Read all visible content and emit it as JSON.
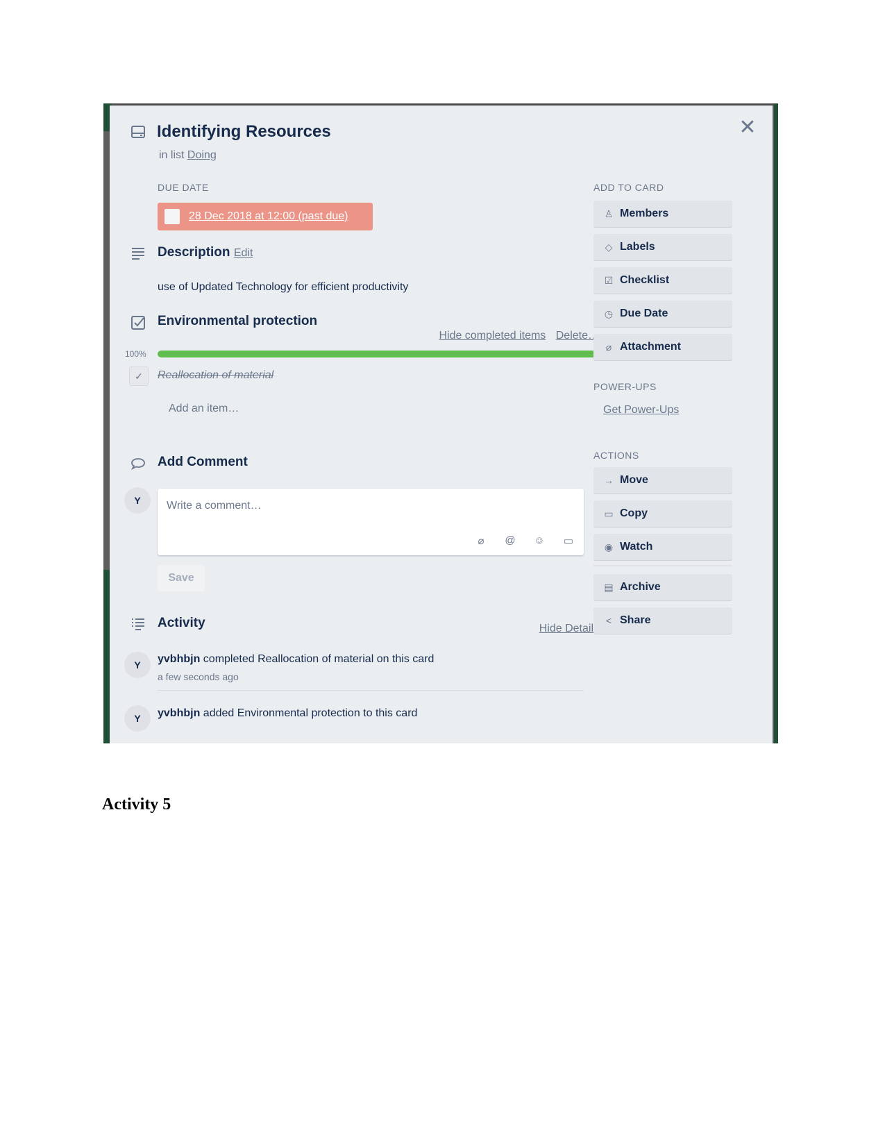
{
  "card": {
    "title": "Identifying Resources",
    "in_list_prefix": "in list",
    "list_name": "Doing",
    "close_icon": "close-icon"
  },
  "due_date": {
    "label": "Due Date",
    "value": "28 Dec 2018 at 12:00 (past due)",
    "status_color": "#ec9488",
    "completed": false
  },
  "description": {
    "title": "Description",
    "edit_label": "Edit",
    "text": "use of Updated Technology for efficient productivity"
  },
  "checklist": {
    "title": "Environmental protection",
    "hide_completed_label": "Hide completed items",
    "delete_label": "Delete…",
    "progress_percent_label": "100%",
    "progress_fraction": 1.0,
    "progress_color": "#61bd4f",
    "items": [
      {
        "text": "Reallocation of material",
        "checked": true
      }
    ],
    "add_item_label": "Add an item…"
  },
  "comment": {
    "title": "Add Comment",
    "avatar_initial": "Y",
    "placeholder": "Write a comment…",
    "tools": [
      "attachment-icon",
      "mention-icon",
      "emoji-icon",
      "card-icon"
    ],
    "tool_glyphs": [
      "⌀",
      "@",
      "☺",
      "▭"
    ],
    "save_label": "Save"
  },
  "activity": {
    "title": "Activity",
    "hide_details_label": "Hide Details",
    "entries": [
      {
        "avatar": "Y",
        "user": "yvbhbjn",
        "action": "completed Reallocation of material on this card",
        "time": "a few seconds ago"
      },
      {
        "avatar": "Y",
        "user": "yvbhbjn",
        "action": "added Environmental protection to this card",
        "time": ""
      }
    ]
  },
  "sidebar": {
    "add_to_card_label": "Add to Card",
    "add_to_card": [
      {
        "label": "Members",
        "icon": "person-icon",
        "glyph": "♙"
      },
      {
        "label": "Labels",
        "icon": "tag-icon",
        "glyph": "◇"
      },
      {
        "label": "Checklist",
        "icon": "checklist-icon",
        "glyph": "☑"
      },
      {
        "label": "Due Date",
        "icon": "clock-icon",
        "glyph": "◷"
      },
      {
        "label": "Attachment",
        "icon": "paperclip-icon",
        "glyph": "⌀"
      }
    ],
    "powerups_label": "Power-Ups",
    "get_powerups_label": "Get Power-Ups",
    "actions_label": "Actions",
    "actions": [
      {
        "label": "Move",
        "icon": "arrow-right-icon",
        "glyph": "→"
      },
      {
        "label": "Copy",
        "icon": "copy-icon",
        "glyph": "▭"
      },
      {
        "label": "Watch",
        "icon": "eye-icon",
        "glyph": "◉"
      },
      {
        "label": "Archive",
        "icon": "archive-icon",
        "glyph": "▤"
      },
      {
        "label": "Share",
        "icon": "share-icon",
        "glyph": "<"
      }
    ]
  },
  "document": {
    "heading": "Activity 5"
  }
}
